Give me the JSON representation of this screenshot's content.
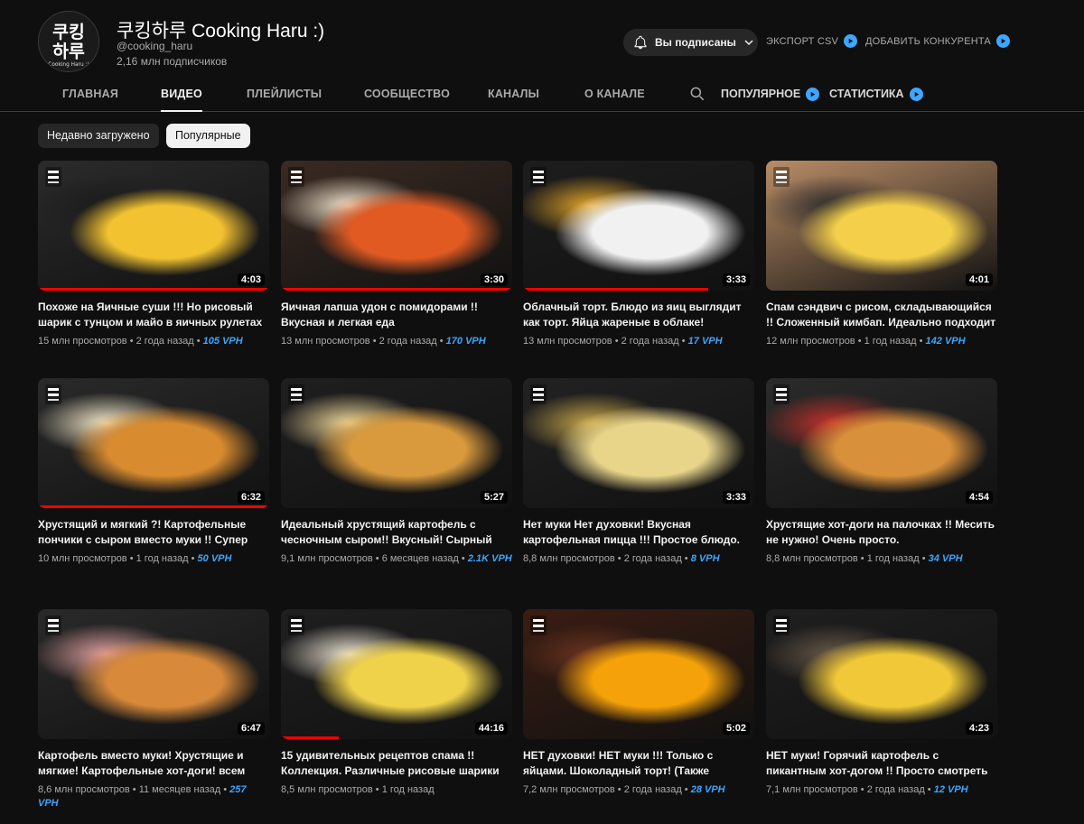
{
  "channel": {
    "avatar_line1": "쿠킹",
    "avatar_line2": "하루",
    "avatar_caption": "Cooking Haru :)",
    "name": "쿠킹하루 Cooking Haru :)",
    "handle": "@cooking_haru",
    "subscribers": "2,16 млн подписчиков"
  },
  "header_actions": {
    "subscribed_label": "Вы подписаны",
    "export_csv": "ЭКСПОРТ CSV",
    "add_competitor": "ДОБАВИТЬ КОНКУРЕНТА"
  },
  "tabs": {
    "home": "ГЛАВНАЯ",
    "videos": "ВИДЕО",
    "playlists": "ПЛЕЙЛИСТЫ",
    "community": "СООБЩЕСТВО",
    "channels": "КАНАЛЫ",
    "about": "О КАНАЛЕ",
    "popular": "ПОПУЛЯРНОЕ",
    "statistics": "СТАТИСТИКА"
  },
  "chips": {
    "recent": "Недавно загружено",
    "popular": "Популярные"
  },
  "colors": {
    "background": "#0f0f0f",
    "accent_blue": "#3ea6ff",
    "progress_red": "#ff0000",
    "chip_active": "#f1f1f1"
  },
  "videos": [
    {
      "title": "Похоже на Яичные суши !!! Но рисовый шарик с тунцом и майо в яичных рулетах",
      "views": "15 млн просмотров",
      "age": "2 года назад",
      "vph": "105 VPH",
      "duration": "4:03",
      "watched": 1.0,
      "palette": [
        "#2b2b2b",
        "#f2c230",
        "#1c1c1c"
      ]
    },
    {
      "title": "Яичная лапша удон с помидорами !! Вкусная и легкая еда",
      "views": "13 млн просмотров",
      "age": "2 года назад",
      "vph": "170 VPH",
      "duration": "3:30",
      "watched": 1.0,
      "palette": [
        "#3a2a22",
        "#e05a22",
        "#f3e6d0"
      ]
    },
    {
      "title": "Облачный торт. Блюдо из яиц выглядит как торт. Яйца жареные в облаке!",
      "views": "13 млн просмотров",
      "age": "2 года назад",
      "vph": "17 VPH",
      "duration": "3:33",
      "watched": 0.8,
      "palette": [
        "#1d1d1d",
        "#f1f1f1",
        "#e8a82a"
      ]
    },
    {
      "title": "Спам сэндвич с рисом, складывающийся !! Сложенный кимбап. Идеально подходит",
      "views": "12 млн просмотров",
      "age": "1 год назад",
      "vph": "142 VPH",
      "duration": "4:01",
      "watched": 0.0,
      "palette": [
        "#b98d66",
        "#f4d04a",
        "#2a2a2a"
      ]
    },
    {
      "title": "Хрустящий и мягкий ?! Картофельные пончики с сыром вместо муки !! Супер",
      "views": "10 млн просмотров",
      "age": "1 год назад",
      "vph": "50 VPH",
      "duration": "6:32",
      "watched": 1.0,
      "palette": [
        "#2a2a2a",
        "#d88b2f",
        "#f5e9c9"
      ]
    },
    {
      "title": "Идеальный хрустящий картофель с чесночным сыром!! Вкусный! Сырный",
      "views": "9,1 млн просмотров",
      "age": "6 месяцев назад",
      "vph": "2.1K VPH",
      "duration": "5:27",
      "watched": 0.0,
      "palette": [
        "#1f1f1f",
        "#d99a3d",
        "#f0d89a"
      ]
    },
    {
      "title": "Нет муки Нет духовки! Вкусная картофельная пицца !!! Простое блюдо.",
      "views": "8,8 млн просмотров",
      "age": "2 года назад",
      "vph": "8 VPH",
      "duration": "3:33",
      "watched": 0.0,
      "palette": [
        "#222222",
        "#e8d58a",
        "#c8a84a"
      ]
    },
    {
      "title": "Хрустящие хот-доги на палочках !! Месить не нужно! Очень просто.",
      "views": "8,8 млн просмотров",
      "age": "1 год назад",
      "vph": "34 VPH",
      "duration": "4:54",
      "watched": 0.0,
      "palette": [
        "#2b2b2b",
        "#d8903a",
        "#c8322a"
      ]
    },
    {
      "title": "Картофель вместо муки! Хрустящие и мягкие! Картофельные хот-доги! всем",
      "views": "8,6 млн просмотров",
      "age": "11 месяцев назад",
      "vph": "257 VPH",
      "duration": "6:47",
      "watched": 0.0,
      "palette": [
        "#2a2a2a",
        "#d8893a",
        "#e2a0a0"
      ]
    },
    {
      "title": "15 удивительных рецептов спама !! Коллекция. Различные рисовые шарики",
      "views": "8,5 млн просмотров",
      "age": "1 год назад",
      "vph": "",
      "duration": "44:16",
      "watched": 0.25,
      "palette": [
        "#1f1f1f",
        "#f0d24a",
        "#e8e0d0"
      ]
    },
    {
      "title": "НЕТ духовки! НЕТ муки !!! Только с яйцами. Шоколадный торт! (Также",
      "views": "7,2 млн просмотров",
      "age": "2 года назад",
      "vph": "28 VPH",
      "duration": "5:02",
      "watched": 0.0,
      "palette": [
        "#3a1d12",
        "#f5a20a",
        "#6b3420"
      ]
    },
    {
      "title": "НЕТ муки! Горячий картофель с пикантным хот-догом !! Просто смотреть",
      "views": "7,1 млн просмотров",
      "age": "2 года назад",
      "vph": "12 VPH",
      "duration": "4:23",
      "watched": 0.0,
      "palette": [
        "#1f1f1f",
        "#f0c838",
        "#6a5a48"
      ]
    }
  ]
}
